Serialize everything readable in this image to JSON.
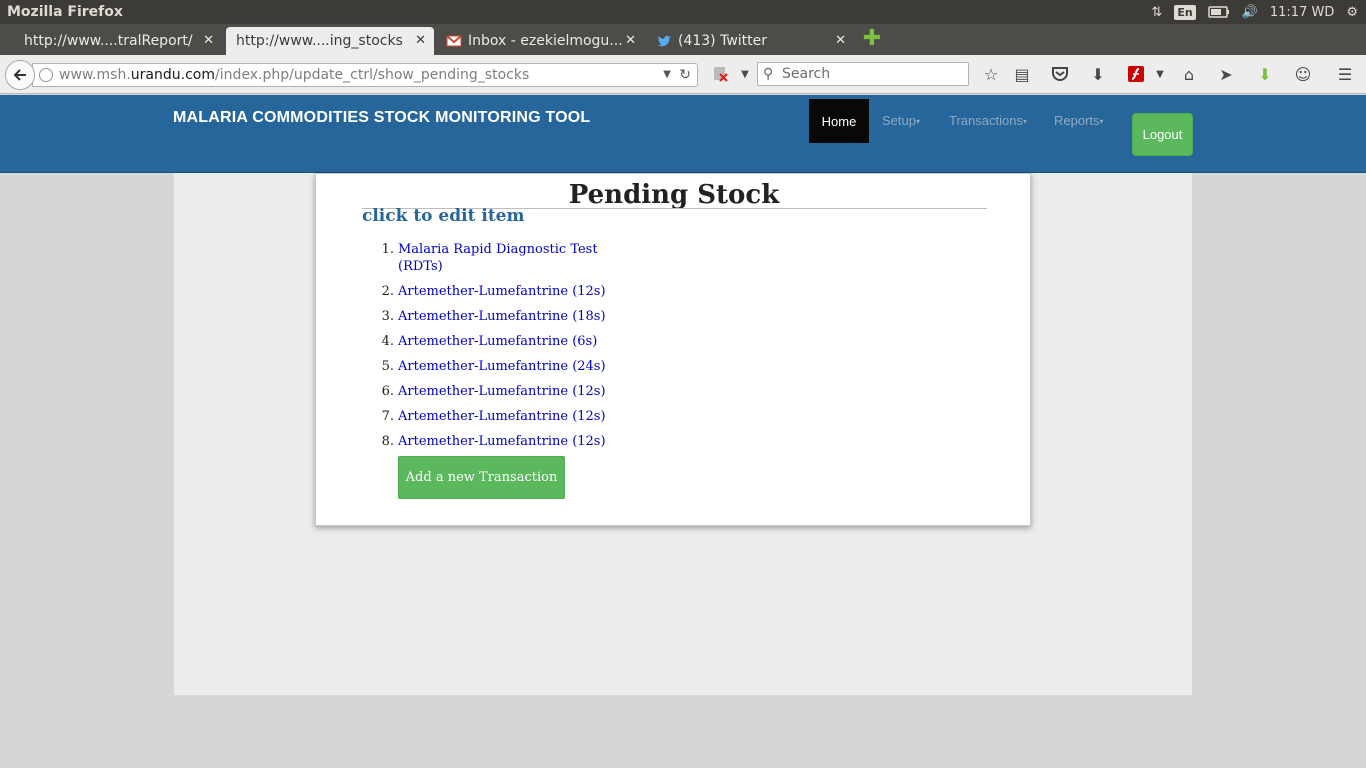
{
  "os": {
    "window_title": "Mozilla Firefox",
    "keyboard_lang": "En",
    "clock": "11:17 WD"
  },
  "browser": {
    "tabs": [
      {
        "label": "http://www....tralReport/",
        "active": false
      },
      {
        "label": "http://www....ing_stocks",
        "active": true
      },
      {
        "label": "Inbox - ezekielmogu...",
        "active": false
      },
      {
        "label": "(413) Twitter",
        "active": false
      }
    ],
    "url": {
      "prefix": "www.msh.",
      "host": "urandu.com",
      "path": "/index.php/update_ctrl/show_pending_stocks"
    },
    "search_placeholder": "Search"
  },
  "app": {
    "brand": "MALARIA COMMODITIES STOCK MONITORING TOOL",
    "nav": {
      "home": "Home",
      "setup": "Setup",
      "transactions": "Transactions",
      "reports": "Reports",
      "logout": "Logout"
    },
    "colors": {
      "navbar": "#26669a",
      "success": "#5cb85c",
      "link": "#0000cc"
    }
  },
  "content": {
    "title": "Pending Stock",
    "subtitle": "click to edit item",
    "items": [
      {
        "num": "1.",
        "label": "Malaria Rapid Diagnostic Test (RDTs)"
      },
      {
        "num": "2.",
        "label": "Artemether-Lumefantrine (12s)"
      },
      {
        "num": "3.",
        "label": "Artemether-Lumefantrine (18s)"
      },
      {
        "num": "4.",
        "label": "Artemether-Lumefantrine (6s)"
      },
      {
        "num": "5.",
        "label": "Artemether-Lumefantrine (24s)"
      },
      {
        "num": "6.",
        "label": "Artemether-Lumefantrine (12s)"
      },
      {
        "num": "7.",
        "label": "Artemether-Lumefantrine (12s)"
      },
      {
        "num": "8.",
        "label": "Artemether-Lumefantrine (12s)"
      }
    ],
    "add_button": "Add a new Transaction"
  }
}
